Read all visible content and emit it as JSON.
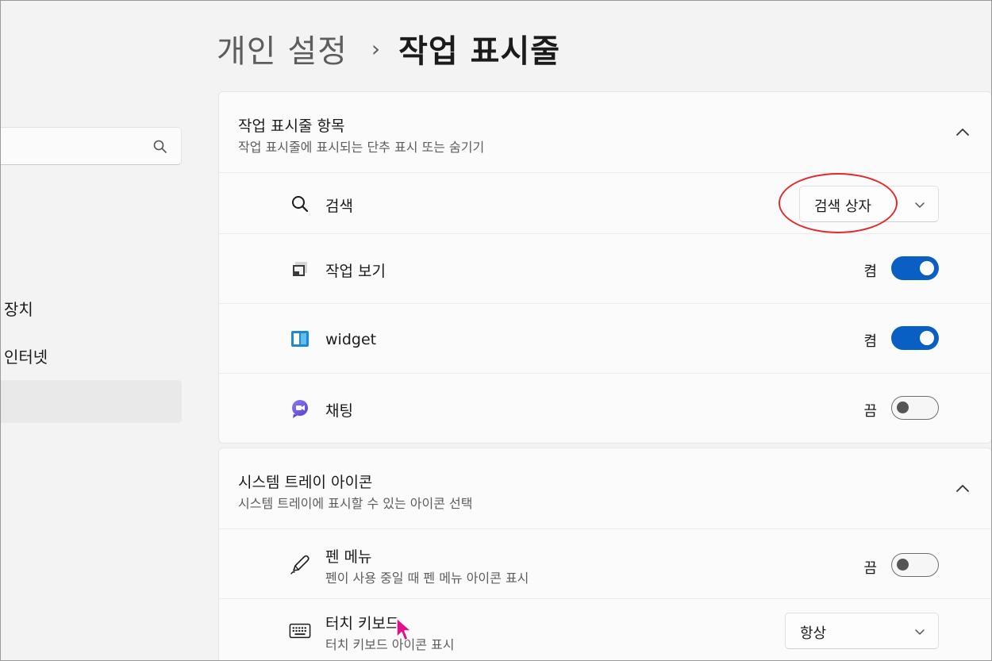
{
  "breadcrumb": {
    "parent": "개인 설정",
    "separator": "›",
    "current": "작업 표시줄"
  },
  "sidebar": {
    "search_icon": "search-icon",
    "items": [
      {
        "label": "장치"
      },
      {
        "label": "인터넷"
      },
      {
        "label": "",
        "selected": true
      }
    ]
  },
  "taskbar_items": {
    "title": "작업 표시줄 항목",
    "description": "작업 표시줄에 표시되는 단추 표시 또는 숨기기",
    "rows": {
      "search": {
        "label": "검색",
        "icon": "search-icon",
        "dropdown_value": "검색 상자"
      },
      "task_view": {
        "label": "작업 보기",
        "icon": "task-view-icon",
        "state": "켬",
        "on": true
      },
      "widget": {
        "label": "widget",
        "icon": "widgets-icon",
        "state": "켬",
        "on": true
      },
      "chat": {
        "label": "채팅",
        "icon": "chat-icon",
        "state": "끔",
        "on": false
      }
    }
  },
  "tray_icons": {
    "title": "시스템 트레이 아이콘",
    "description": "시스템 트레이에 표시할 수 있는 아이콘 선택",
    "rows": {
      "pen_menu": {
        "label": "펜 메뉴",
        "sublabel": "펜이 사용 중일 때 펜 메뉴 아이콘 표시",
        "icon": "pen-icon",
        "state": "끔",
        "on": false
      },
      "touch_keyboard": {
        "label": "터치 키보드",
        "sublabel": "터치 키보드 아이콘 표시",
        "icon": "keyboard-icon",
        "dropdown_value": "항상"
      }
    }
  },
  "colors": {
    "accent": "#0a5fc4",
    "annotation": "#e02c2c",
    "cursor": "#e0108c"
  }
}
